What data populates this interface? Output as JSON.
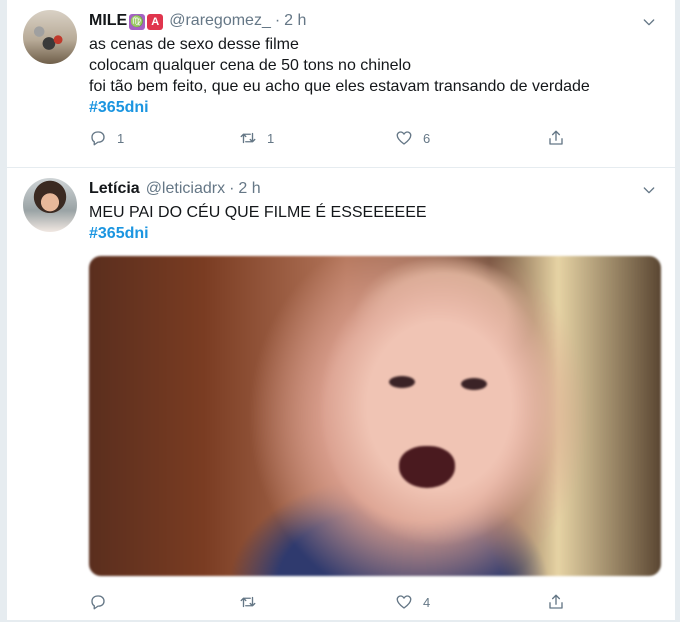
{
  "tweets": [
    {
      "name": "MILE",
      "badges": [
        "♍",
        "A"
      ],
      "handle": "@raregomez_",
      "dot": "·",
      "time": "2 h",
      "lines": [
        "as cenas de sexo desse filme",
        "colocam qualquer cena de 50 tons no chinelo",
        "foi tão bem feito, que eu acho que eles estavam transando de verdade"
      ],
      "hashtag": "#365dni",
      "replies": "1",
      "retweets": "1",
      "likes": "6"
    },
    {
      "name": "Letícia",
      "handle": "@leticiadrx",
      "dot": "·",
      "time": "2 h",
      "lines": [
        "MEU PAI DO CÉU QUE FILME É ESSEEEEEE"
      ],
      "hashtag": "#365dni",
      "replies": "",
      "retweets": "",
      "likes": "4"
    }
  ],
  "colors": {
    "hashtag": "#1b95e0",
    "muted": "#657786",
    "zodiac_badge": "#a562c4",
    "a_badge": "#e0354d"
  },
  "icons": [
    "chevron-down-icon",
    "reply-icon",
    "retweet-icon",
    "like-icon",
    "share-icon"
  ]
}
